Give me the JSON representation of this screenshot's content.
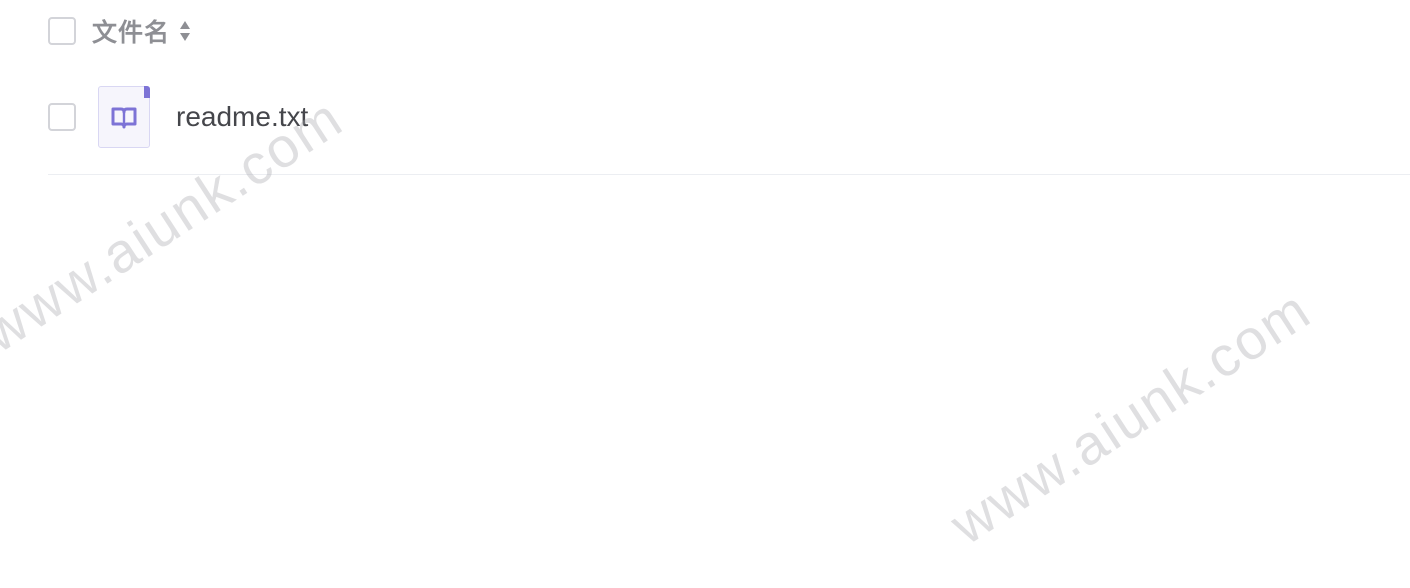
{
  "file_list": {
    "header": {
      "select_all_checked": false,
      "column_title": "文件名",
      "sort_icon": "sort-both-icon"
    },
    "files": [
      {
        "name": "readme.txt",
        "checked": false,
        "icon": "book-icon",
        "icon_color": "#7d73d6"
      }
    ]
  },
  "watermarks": [
    "www.aiunk.com",
    "www.aiunk.com"
  ]
}
